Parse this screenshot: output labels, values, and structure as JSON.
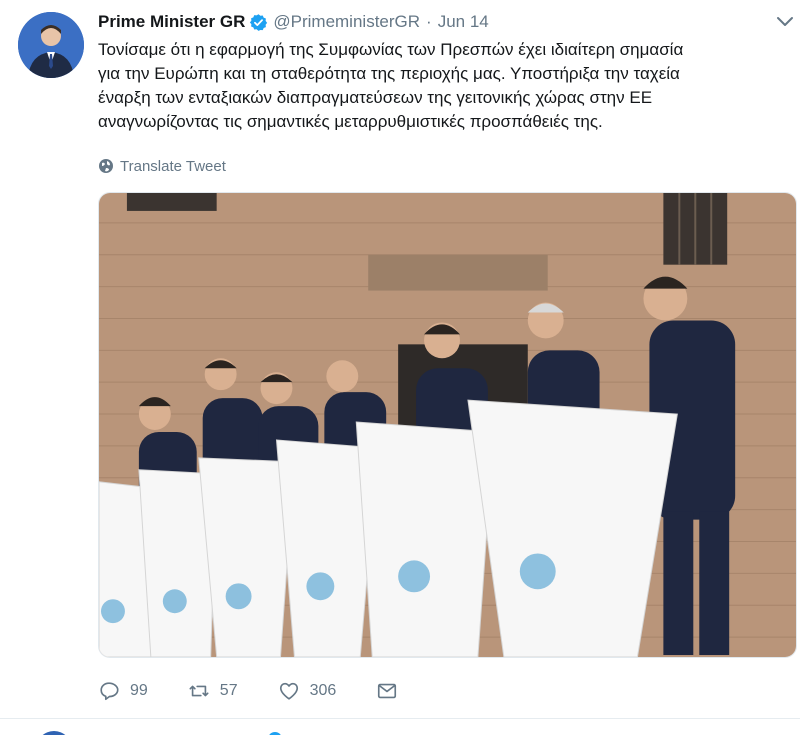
{
  "tweet": {
    "author_name": "Prime Minister GR",
    "handle": "@PrimeministerGR",
    "separator": "·",
    "time": "Jun 14",
    "text": "Τονίσαμε ότι η εφαρμογή της Συμφωνίας των Πρεσπών έχει ιδιαίτερη σημασία\nγια την Ευρώπη και τη σταθερότητα της περιοχής μας. Υποστήριξα την ταχεία\nέναρξη των ενταξιακών διαπραγματεύσεων της γειτονικής χώρας στην ΕΕ\nαναγνωρίζοντας τις σημαντικές μεταρρυθμιστικές προσπάθειές της.",
    "translate_label": "Translate Tweet",
    "icons": {
      "verified": "verified-badge-icon",
      "caret": "chevron-down-icon",
      "translate": "globe-icon",
      "reply": "reply-icon",
      "retweet": "retweet-icon",
      "like": "heart-icon",
      "message": "envelope-icon"
    },
    "stats": {
      "replies": "99",
      "retweets": "57",
      "likes": "306"
    },
    "colors": {
      "verified": "#1da1f2",
      "secondary_text": "#657786"
    }
  }
}
